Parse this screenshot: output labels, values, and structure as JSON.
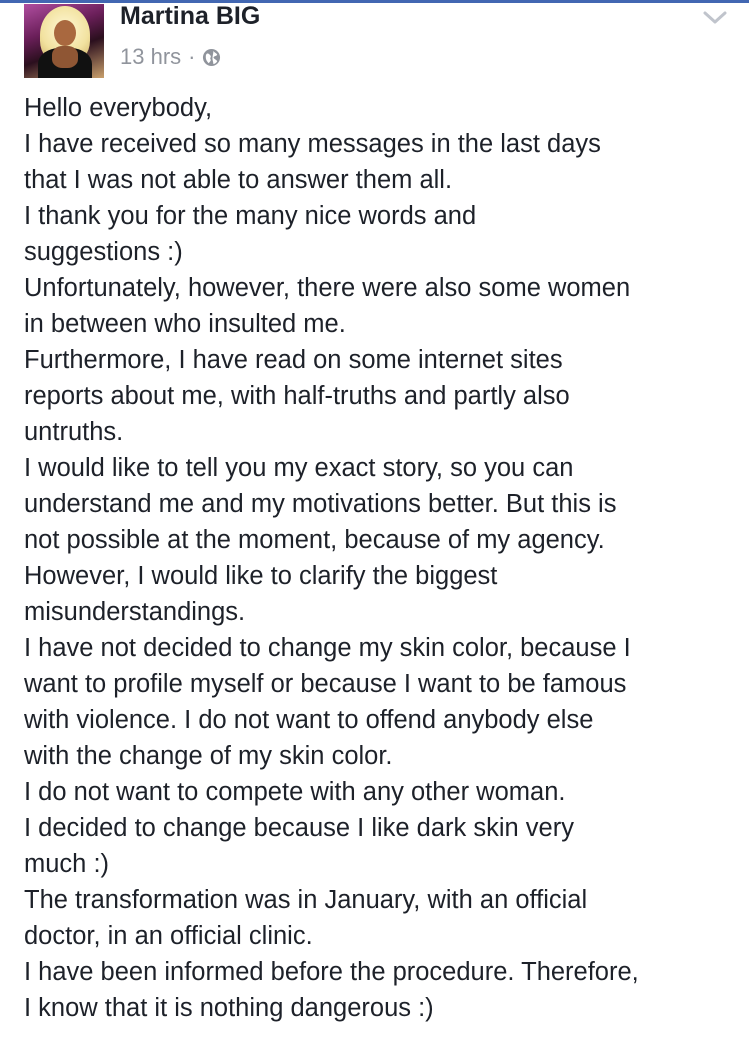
{
  "post": {
    "author": "Martina BIG",
    "timestamp": "13 hrs",
    "separator": "·",
    "privacy_icon": "globe-icon",
    "menu_icon": "chevron-down-icon",
    "avatar_icon": "profile-photo",
    "lines": [
      "Hello everybody,",
      "I have received so many messages in the last days",
      "that I was not able to answer them all.",
      "I thank you for the many nice words and",
      "suggestions :)",
      "Unfortunately, however, there were also some women",
      "in between who insulted me.",
      "Furthermore, I have read on some internet sites",
      "reports about me, with half-truths and partly also",
      "untruths.",
      "I would like to tell you my exact story, so you can",
      "understand me and my motivations better. But this is",
      "not possible at the moment, because of my agency.",
      "However, I would like to clarify the biggest",
      "misunderstandings.",
      "I have not decided to change my skin color, because I",
      "want to profile myself or because I want to be famous",
      "with violence. I do not want to offend anybody else",
      "with the change of my skin color.",
      "I do not want to compete with any other woman.",
      "I decided to change because I like dark skin very",
      "much :)",
      "The transformation was in January, with an official",
      "doctor, in an official clinic.",
      "I have been informed before the procedure. Therefore,",
      "I know that it is nothing dangerous :)"
    ]
  },
  "colors": {
    "accent": "#4267b2",
    "text": "#1d2129",
    "meta": "#90949c"
  }
}
